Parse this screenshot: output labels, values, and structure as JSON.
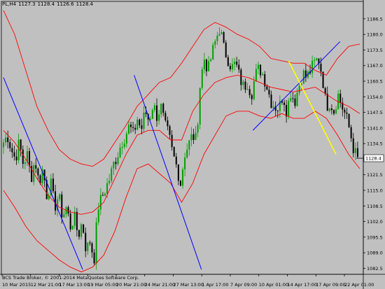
{
  "header": {
    "symbol": "PL,H4",
    "open": "1127.3",
    "high": "1128.4",
    "low": "1126.6",
    "close": "1128.4"
  },
  "footer": {
    "copyright": "BCS Trade Broker, © 2001-2014 MetaQuotes Software Corp."
  },
  "colors": {
    "background": "#c0c0c0",
    "bull_candle": "#00a000",
    "bear_candle": "#000000",
    "envelope": "#ff0000",
    "trendline_blue": "#0000ff",
    "trendline_yellow": "#ffff00",
    "price_label_bg": "#ffffff"
  },
  "chart_data": {
    "type": "candlestick",
    "ylim": [
      1080,
      1192
    ],
    "y_ticks": [
      "1186.5",
      "1180.0",
      "1173.5",
      "1167.0",
      "1160.5",
      "1154.0",
      "1147.5",
      "1141.0",
      "1134.5",
      "1128.0",
      "1121.5",
      "1115.0",
      "1108.5",
      "1102.0",
      "1095.5",
      "1089.0",
      "1082.5"
    ],
    "x_ticks": [
      "10 Mar 2015",
      "12 Mar 21:00",
      "17 Mar 13:00",
      "19 Mar 05:00",
      "20 Mar 21:00",
      "24 Mar 21:00",
      "27 Mar 13:00",
      "1 Apr 17:00",
      "7 Apr 09:00",
      "10 Apr 01:00",
      "14 Apr 17:00",
      "17 Apr 09:00",
      "22 Apr 01:00"
    ],
    "current_price": "1128.4",
    "candle_close_path": [
      1135,
      1138,
      1132,
      1128,
      1135,
      1126,
      1130,
      1120,
      1128,
      1118,
      1124,
      1113,
      1118,
      1108,
      1113,
      1104,
      1108,
      1100,
      1104,
      1096,
      1102,
      1090,
      1094,
      1086,
      1108,
      1112,
      1116,
      1120,
      1126,
      1130,
      1135,
      1138,
      1142,
      1138,
      1145,
      1140,
      1148,
      1144,
      1151,
      1146,
      1150,
      1142,
      1138,
      1130,
      1125,
      1118,
      1130,
      1134,
      1138,
      1136,
      1160,
      1170,
      1165,
      1172,
      1178,
      1183,
      1174,
      1170,
      1166,
      1168,
      1162,
      1158,
      1160,
      1155,
      1163,
      1166,
      1163,
      1158,
      1152,
      1150,
      1149,
      1155,
      1148,
      1156,
      1152,
      1158,
      1164,
      1162,
      1165,
      1168,
      1170,
      1163,
      1150,
      1152,
      1148,
      1155,
      1150,
      1146,
      1140,
      1132,
      1128
    ],
    "envelope_upper": [
      1190,
      1180,
      1165,
      1150,
      1140,
      1132,
      1128,
      1126,
      1125,
      1128,
      1135,
      1142,
      1150,
      1155,
      1160,
      1162,
      1168,
      1175,
      1182,
      1185,
      1183,
      1180,
      1178,
      1175,
      1170,
      1169,
      1168,
      1168,
      1165,
      1163,
      1170,
      1175,
      1176
    ],
    "envelope_mid": [
      1140,
      1135,
      1128,
      1120,
      1113,
      1108,
      1106,
      1105,
      1106,
      1110,
      1120,
      1130,
      1138,
      1140,
      1140,
      1136,
      1136,
      1148,
      1155,
      1160,
      1162,
      1163,
      1162,
      1160,
      1158,
      1157,
      1156,
      1157,
      1158,
      1155,
      1152,
      1150,
      1147
    ],
    "envelope_lower": [
      1115,
      1108,
      1100,
      1094,
      1090,
      1086,
      1083,
      1081,
      1083,
      1088,
      1098,
      1112,
      1124,
      1126,
      1122,
      1118,
      1110,
      1118,
      1130,
      1138,
      1146,
      1148,
      1148,
      1146,
      1145,
      1147,
      1145,
      1145,
      1148,
      1145,
      1138,
      1130,
      1124
    ],
    "blue_lines": [
      {
        "from": [
          0,
          1162
        ],
        "to": [
          20,
          1082
        ]
      },
      {
        "from": [
          33,
          1163
        ],
        "to": [
          50,
          1082
        ]
      },
      {
        "from": [
          63,
          1140
        ],
        "to": [
          85,
          1177
        ]
      }
    ],
    "yellow_line": {
      "from": [
        72,
        1169
      ],
      "to": [
        84,
        1130
      ]
    }
  }
}
